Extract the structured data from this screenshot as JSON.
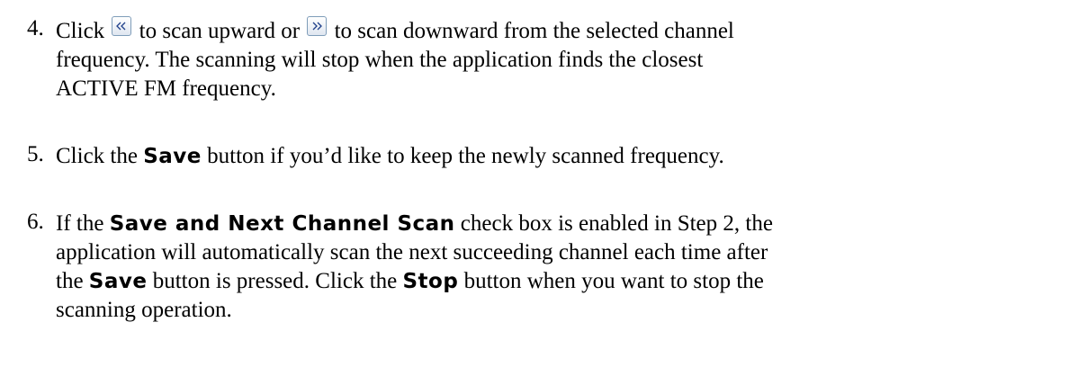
{
  "steps": [
    {
      "number": "4.",
      "line1_pre": "Click",
      "scan_up_icon": "double-chevron-left-icon",
      "line1_mid": "to scan upward or",
      "scan_down_icon": "double-chevron-right-icon",
      "line1_post": "to scan downward from the selected channel",
      "line2": "frequency. The scanning will stop when the application finds the closest",
      "line3": "ACTIVE FM frequency."
    },
    {
      "number": "5.",
      "pre": "Click the",
      "bold": "Save",
      "post": "button if you’d like to keep the newly scanned frequency."
    },
    {
      "number": "6.",
      "line1_pre": "If the",
      "line1_bold": "Save and Next Channel Scan",
      "line1_post": "check box is enabled in Step 2, the",
      "line2": "application will automatically scan the next succeeding channel each time after",
      "line3_pre": "the",
      "line3_bold1": "Save",
      "line3_mid": "button is pressed. Click the",
      "line3_bold2": "Stop",
      "line3_post": "button when you want to stop the",
      "line4": "scanning operation."
    }
  ],
  "colors": {
    "text": "#000000",
    "button_border": "#7f9db9",
    "icon": "#1f3f8a"
  }
}
